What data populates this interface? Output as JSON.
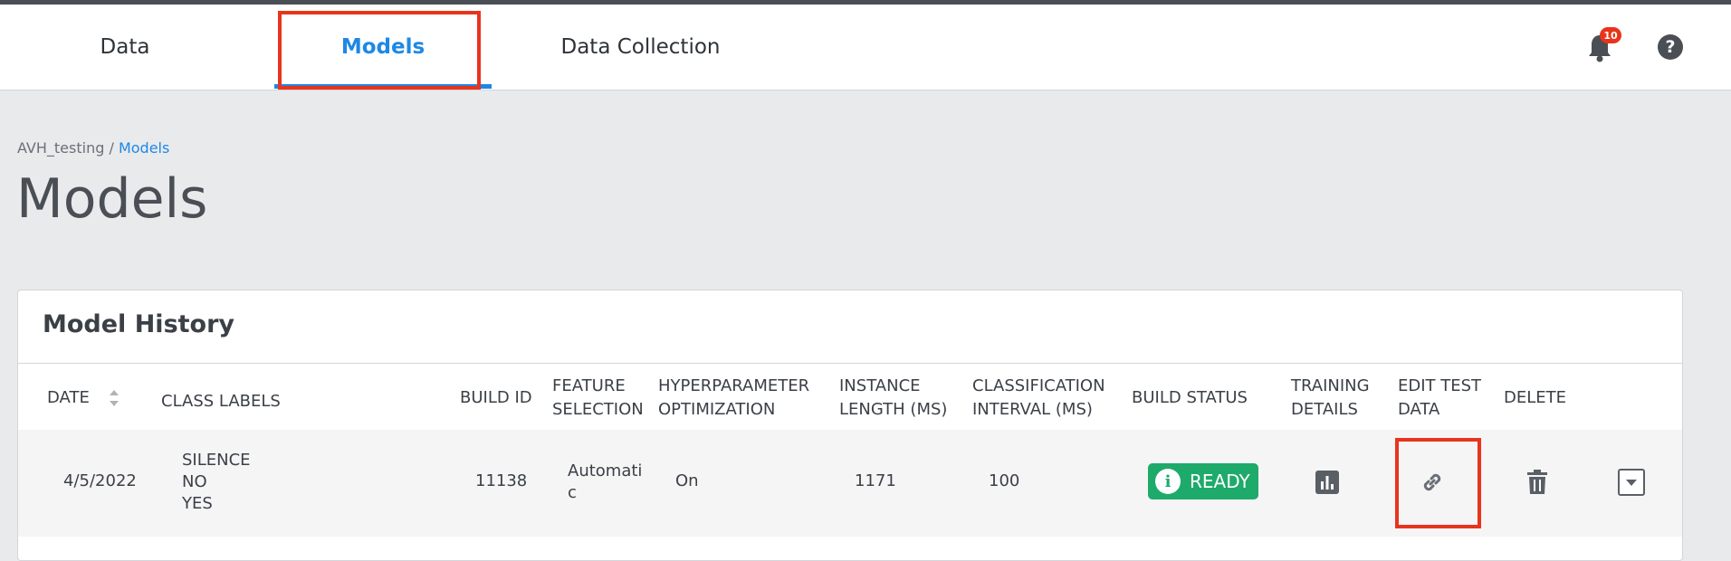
{
  "nav": {
    "tabs": [
      {
        "label": "Data"
      },
      {
        "label": "Models"
      },
      {
        "label": "Data Collection"
      }
    ],
    "notification_count": "10",
    "help_label": "?"
  },
  "breadcrumb": {
    "project": "AVH_testing",
    "separator": " / ",
    "current": "Models"
  },
  "page_title": "Models",
  "model_history": {
    "title": "Model History",
    "headers": {
      "date": "DATE",
      "class_labels": "CLASS LABELS",
      "build_id": "BUILD ID",
      "feature_selection": "FEATURE SELECTION",
      "hyperparameter_optimization": "HYPERPARAMETER OPTIMIZATION",
      "instance_length": "INSTANCE LENGTH (MS)",
      "classification_interval": "CLASSIFICATION INTERVAL (MS)",
      "build_status": "BUILD STATUS",
      "training_details": "TRAINING DETAILS",
      "edit_test_data": "EDIT TEST DATA",
      "delete": "DELETE"
    },
    "rows": [
      {
        "date": "4/5/2022",
        "class_labels": [
          "SILENCE",
          "NO",
          "YES"
        ],
        "build_id": "11138",
        "feature_selection": "Automatic",
        "hyperparameter_optimization": "On",
        "instance_length": "1171",
        "classification_interval": "100",
        "build_status": "READY"
      }
    ]
  },
  "colors": {
    "accent": "#1e88e5",
    "highlight": "#e8341c",
    "status_ready": "#1eaa6b"
  },
  "icons": [
    "bell-icon",
    "help-icon",
    "sort-icon",
    "info-icon",
    "bar-chart-icon",
    "link-icon",
    "trash-icon",
    "chevron-down-icon"
  ]
}
